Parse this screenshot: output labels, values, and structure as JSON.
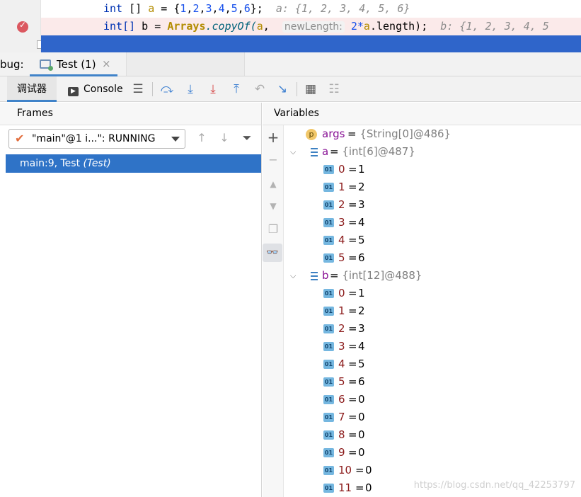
{
  "editor": {
    "line1": {
      "type": "int",
      "brackets": " [] ",
      "name": "a",
      "assign": " = {",
      "values": [
        "1",
        "2",
        "3",
        "4",
        "5",
        "6"
      ],
      "end": "};",
      "hint": "a: {1, 2, 3, 4, 5, 6}"
    },
    "line2": {
      "type": "int[]",
      "name": " b = ",
      "cls": "Arrays",
      "method": ".copyOf(",
      "arg1": "a",
      "comma": ",",
      "hint_label": "newLength:",
      "mult": " 2*",
      "arg2": "a",
      "tail": ".length);",
      "hint": "b: {1, 2, 3, 4, 5"
    }
  },
  "tabbar": {
    "debug_label": "bug:",
    "tab_title": "Test (1)",
    "tab_close": "×"
  },
  "toolbar": {
    "debugger_label": "调试器",
    "console_label": "Console",
    "console_icon": "▶",
    "icons": [
      "menu-icon",
      "step-over-icon",
      "step-into-icon",
      "force-step-into-icon",
      "step-out-icon",
      "drop-frame-icon",
      "run-to-cursor-icon",
      "evaluate-icon",
      "trace-icon"
    ]
  },
  "frames": {
    "title": "Frames",
    "thread": "\"main\"@1 i...\": RUNNING",
    "selected_frame": "main:9, Test ",
    "selected_frame_class": "(Test)"
  },
  "variables": {
    "title": "Variables",
    "args": {
      "name": "args",
      "eq": " = ",
      "ref": "{String[0]@486}"
    },
    "a": {
      "name": "a",
      "eq": " = ",
      "ref": "{int[6]@487}",
      "items": [
        {
          "i": "0",
          "v": "1"
        },
        {
          "i": "1",
          "v": "2"
        },
        {
          "i": "2",
          "v": "3"
        },
        {
          "i": "3",
          "v": "4"
        },
        {
          "i": "4",
          "v": "5"
        },
        {
          "i": "5",
          "v": "6"
        }
      ]
    },
    "b": {
      "name": "b",
      "eq": " = ",
      "ref": "{int[12]@488}",
      "items": [
        {
          "i": "0",
          "v": "1"
        },
        {
          "i": "1",
          "v": "2"
        },
        {
          "i": "2",
          "v": "3"
        },
        {
          "i": "3",
          "v": "4"
        },
        {
          "i": "4",
          "v": "5"
        },
        {
          "i": "5",
          "v": "6"
        },
        {
          "i": "6",
          "v": "0"
        },
        {
          "i": "7",
          "v": "0"
        },
        {
          "i": "8",
          "v": "0"
        },
        {
          "i": "9",
          "v": "0"
        },
        {
          "i": "10",
          "v": "0"
        },
        {
          "i": "11",
          "v": "0"
        }
      ]
    }
  },
  "watermark": "https://blog.csdn.net/qq_42253797"
}
